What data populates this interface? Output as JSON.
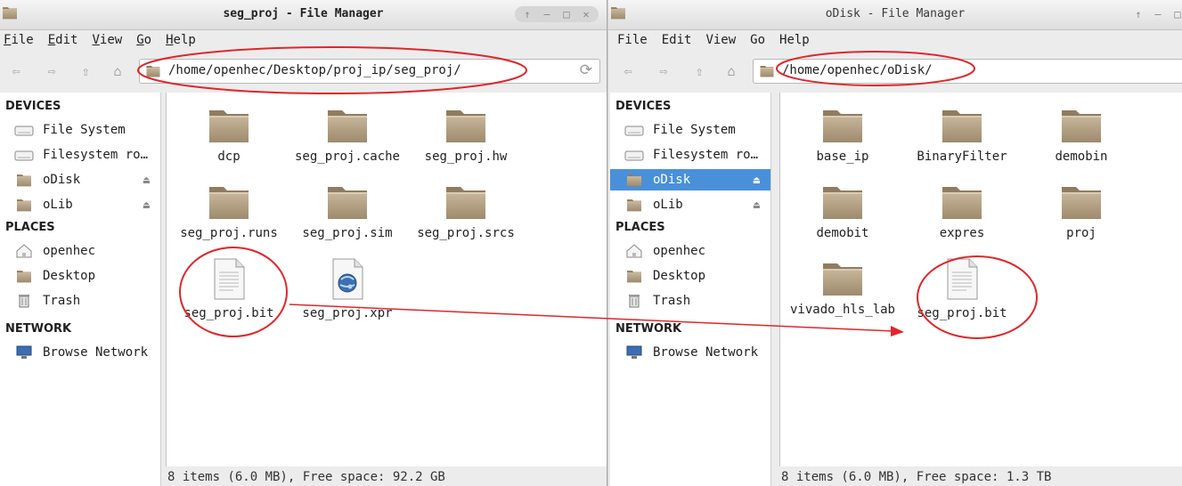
{
  "left": {
    "title": "seg_proj - File Manager",
    "menu": [
      {
        "label": "File",
        "u": "F",
        "rest": "ile"
      },
      {
        "label": "Edit",
        "u": "E",
        "rest": "dit"
      },
      {
        "label": "View",
        "u": "V",
        "rest": "iew"
      },
      {
        "label": "Go",
        "u": "G",
        "rest": "o"
      },
      {
        "label": "Help",
        "u": "H",
        "rest": "elp"
      }
    ],
    "path": "/home/openhec/Desktop/proj_ip/seg_proj/",
    "sidebar": {
      "devices_heading": "DEVICES",
      "devices": [
        "File System",
        "Filesystem ro…",
        "oDisk",
        "oLib"
      ],
      "places_heading": "PLACES",
      "places": [
        "openhec",
        "Desktop",
        "Trash"
      ],
      "network_heading": "NETWORK",
      "network": [
        "Browse Network"
      ]
    },
    "files": [
      {
        "name": "dcp",
        "type": "folder"
      },
      {
        "name": "seg_proj.cache",
        "type": "folder"
      },
      {
        "name": "seg_proj.hw",
        "type": "folder"
      },
      {
        "name": "seg_proj.runs",
        "type": "folder"
      },
      {
        "name": "seg_proj.sim",
        "type": "folder"
      },
      {
        "name": "seg_proj.srcs",
        "type": "folder"
      },
      {
        "name": "seg_proj.bit",
        "type": "file"
      },
      {
        "name": "seg_proj.xpr",
        "type": "xpr"
      }
    ],
    "status": "8 items (6.0 MB), Free space: 92.2 GB"
  },
  "right": {
    "title": "oDisk - File Manager",
    "menu": [
      {
        "label": "File"
      },
      {
        "label": "Edit"
      },
      {
        "label": "View"
      },
      {
        "label": "Go"
      },
      {
        "label": "Help"
      }
    ],
    "path": "/home/openhec/oDisk/",
    "sidebar": {
      "devices_heading": "DEVICES",
      "devices": [
        "File System",
        "Filesystem ro…",
        "oDisk",
        "oLib"
      ],
      "selected_device": "oDisk",
      "places_heading": "PLACES",
      "places": [
        "openhec",
        "Desktop",
        "Trash"
      ],
      "network_heading": "NETWORK",
      "network": [
        "Browse Network"
      ]
    },
    "files": [
      {
        "name": "base_ip",
        "type": "folder"
      },
      {
        "name": "BinaryFilter",
        "type": "folder"
      },
      {
        "name": "demobin",
        "type": "folder"
      },
      {
        "name": "demobit",
        "type": "folder"
      },
      {
        "name": "expres",
        "type": "folder"
      },
      {
        "name": "proj",
        "type": "folder"
      },
      {
        "name": "vivado_hls_lab",
        "type": "folder"
      },
      {
        "name": "seg_proj.bit",
        "type": "file"
      }
    ],
    "status": "8 items (6.0 MB), Free space: 1.3 TB"
  },
  "colors": {
    "selection": "#4a90d9",
    "annotation": "#e0262a",
    "folder": "#b5a185"
  }
}
